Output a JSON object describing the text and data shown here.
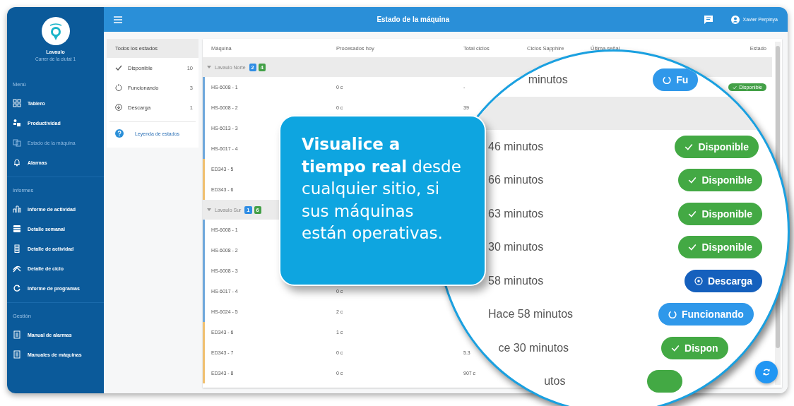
{
  "sidebar": {
    "brand": "Lavaulo",
    "address": "Carrer de la ciutat 1",
    "sections": [
      {
        "title": "Menú",
        "items": [
          {
            "label": "Tablero",
            "selected": false
          },
          {
            "label": "Productividad",
            "selected": false
          },
          {
            "label": "Estado de la máquina",
            "selected": true
          },
          {
            "label": "Alarmas",
            "selected": false
          }
        ]
      },
      {
        "title": "Informes",
        "items": [
          {
            "label": "Informe de actividad",
            "selected": false
          },
          {
            "label": "Detalle semanal",
            "selected": false
          },
          {
            "label": "Detalle de actividad",
            "selected": false
          },
          {
            "label": "Detalle de ciclo",
            "selected": false
          },
          {
            "label": "Informe de programas",
            "selected": false
          }
        ]
      },
      {
        "title": "Gestión",
        "items": [
          {
            "label": "Manual de alarmas",
            "selected": false
          },
          {
            "label": "Manuales de máquinas",
            "selected": false
          }
        ]
      }
    ]
  },
  "topbar": {
    "title": "Estado de la máquina",
    "user": "Xavier Perpinya"
  },
  "filters": {
    "items": [
      {
        "kind": "all",
        "label": "Todos los estados",
        "selected": true
      },
      {
        "kind": "disponible",
        "label": "Disponible",
        "count": "10",
        "selected": false
      },
      {
        "kind": "funcionando",
        "label": "Funcionando",
        "count": "3",
        "selected": false
      },
      {
        "kind": "descarga",
        "label": "Descarga",
        "count": "1",
        "selected": false
      }
    ],
    "legend_link": "Leyenda de estados"
  },
  "table": {
    "columns": [
      "Máquina",
      "Procesados hoy",
      "Total ciclos",
      "Ciclos Sapphire",
      "Última señal",
      "Estado"
    ],
    "groups": [
      {
        "name": "Lavaulo Norte",
        "expanded": true,
        "badges": [
          {
            "text": "2",
            "color": "#2f8de4"
          },
          {
            "text": "4",
            "color": "#43a047"
          }
        ],
        "rows": [
          {
            "machine": "HS-6008 - 1",
            "color": "#6fa8dc",
            "processed": "0 c",
            "total": "-",
            "status": "Disponible"
          },
          {
            "machine": "HS-6008 - 2",
            "color": "#6fa8dc",
            "processed": "0 c",
            "total": "39"
          },
          {
            "machine": "HS-6013 - 3",
            "color": "#6fa8dc"
          },
          {
            "machine": "HS-6017 - 4",
            "color": "#6fa8dc"
          },
          {
            "machine": "ED343 - 5",
            "color": "#f0c070"
          },
          {
            "machine": "ED343 - 6",
            "color": "#f0c070"
          }
        ]
      },
      {
        "name": "Lavaulo Sur",
        "expanded": true,
        "badges": [
          {
            "text": "1",
            "color": "#2f8de4"
          },
          {
            "text": "6",
            "color": "#43a047"
          }
        ],
        "rows": [
          {
            "machine": "HS-6008 - 1",
            "color": "#6fa8dc"
          },
          {
            "machine": "HS-6008 - 2",
            "color": "#6fa8dc"
          },
          {
            "machine": "HS-6008 - 3",
            "color": "#6fa8dc"
          },
          {
            "machine": "HS-6017 - 4",
            "color": "#6fa8dc",
            "processed": "0 c"
          },
          {
            "machine": "HS-6024 - 5",
            "color": "#6fa8dc",
            "processed": "2 c"
          },
          {
            "machine": "ED343 - 6",
            "color": "#f0c070",
            "processed": "1 c"
          },
          {
            "machine": "ED343 - 7",
            "color": "#f0c070",
            "processed": "0 c",
            "total": "5.3"
          },
          {
            "machine": "ED343 - 8",
            "color": "#f0c070",
            "processed": "0 c",
            "total": "907 c"
          }
        ]
      }
    ]
  },
  "magnifier": {
    "rows": [
      {
        "kind": "machine",
        "signal": "minutos",
        "status": {
          "kind": "funcionando",
          "label": "Fu"
        }
      },
      {
        "kind": "group"
      },
      {
        "kind": "machine",
        "signal": "46 minutos",
        "status": {
          "kind": "disponible",
          "label": "Disponible"
        }
      },
      {
        "kind": "machine",
        "signal": "66 minutos",
        "status": {
          "kind": "disponible",
          "label": "Disponible"
        }
      },
      {
        "kind": "machine",
        "signal": "63 minutos",
        "status": {
          "kind": "disponible",
          "label": "Disponible"
        }
      },
      {
        "kind": "machine",
        "signal": "30 minutos",
        "status": {
          "kind": "disponible",
          "label": "Disponible"
        }
      },
      {
        "kind": "machine",
        "signal": "58 minutos",
        "status": {
          "kind": "descarga",
          "label": "Descarga"
        }
      },
      {
        "kind": "machine",
        "signal": "Hace 58 minutos",
        "status": {
          "kind": "funcionando",
          "label": "Funcionando"
        }
      },
      {
        "kind": "machine",
        "signal": "ce 30 minutos",
        "status": {
          "kind": "disponible",
          "label": "Dispon"
        }
      },
      {
        "kind": "machine",
        "signal": "utos",
        "status": {
          "kind": "disponible"
        }
      }
    ]
  },
  "callout": {
    "text": "**Visualice a tiempo real** desde cualquier sitio, si sus máquinas están operativas."
  }
}
